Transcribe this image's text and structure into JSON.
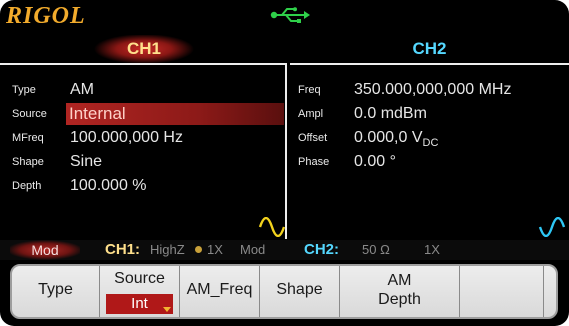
{
  "brand": {
    "logo": "RIGOL"
  },
  "icons": {
    "usb": "usb-icon",
    "wave": "sine-wave-icon"
  },
  "colors": {
    "ch1": "#ffe08c",
    "ch2": "#55d8ff",
    "accent": "#b01818",
    "logo": "#f2ab2c"
  },
  "tabs": {
    "ch1": "CH1",
    "ch2": "CH2"
  },
  "ch1": {
    "type_label": "Type",
    "type_value": "AM",
    "source_label": "Source",
    "source_value": "Internal",
    "mfreq_label": "MFreq",
    "mfreq_value": "100.000,000 Hz",
    "shape_label": "Shape",
    "shape_value": "Sine",
    "depth_label": "Depth",
    "depth_value": "100.000 %"
  },
  "ch2": {
    "freq_label": "Freq",
    "freq_value": "350.000,000,000 MHz",
    "ampl_label": "Ampl",
    "ampl_value": "0.0 mdBm",
    "offset_label": "Offset",
    "offset_value": "0.000,0 V",
    "offset_unit_sub": "DC",
    "phase_label": "Phase",
    "phase_value": "0.00 °"
  },
  "status": {
    "mod": "Mod",
    "ch1_label": "CH1:",
    "ch1_impedance": "HighZ",
    "ch1_multiplier": "1X",
    "ch1_mod": "Mod",
    "ch2_label": "CH2:",
    "ch2_impedance": "50 Ω",
    "ch2_multiplier": "1X"
  },
  "menu": {
    "type": "Type",
    "source": "Source",
    "source_option": "Int",
    "am_freq": "AM_Freq",
    "shape": "Shape",
    "am_depth_line1": "AM",
    "am_depth_line2": "Depth"
  }
}
